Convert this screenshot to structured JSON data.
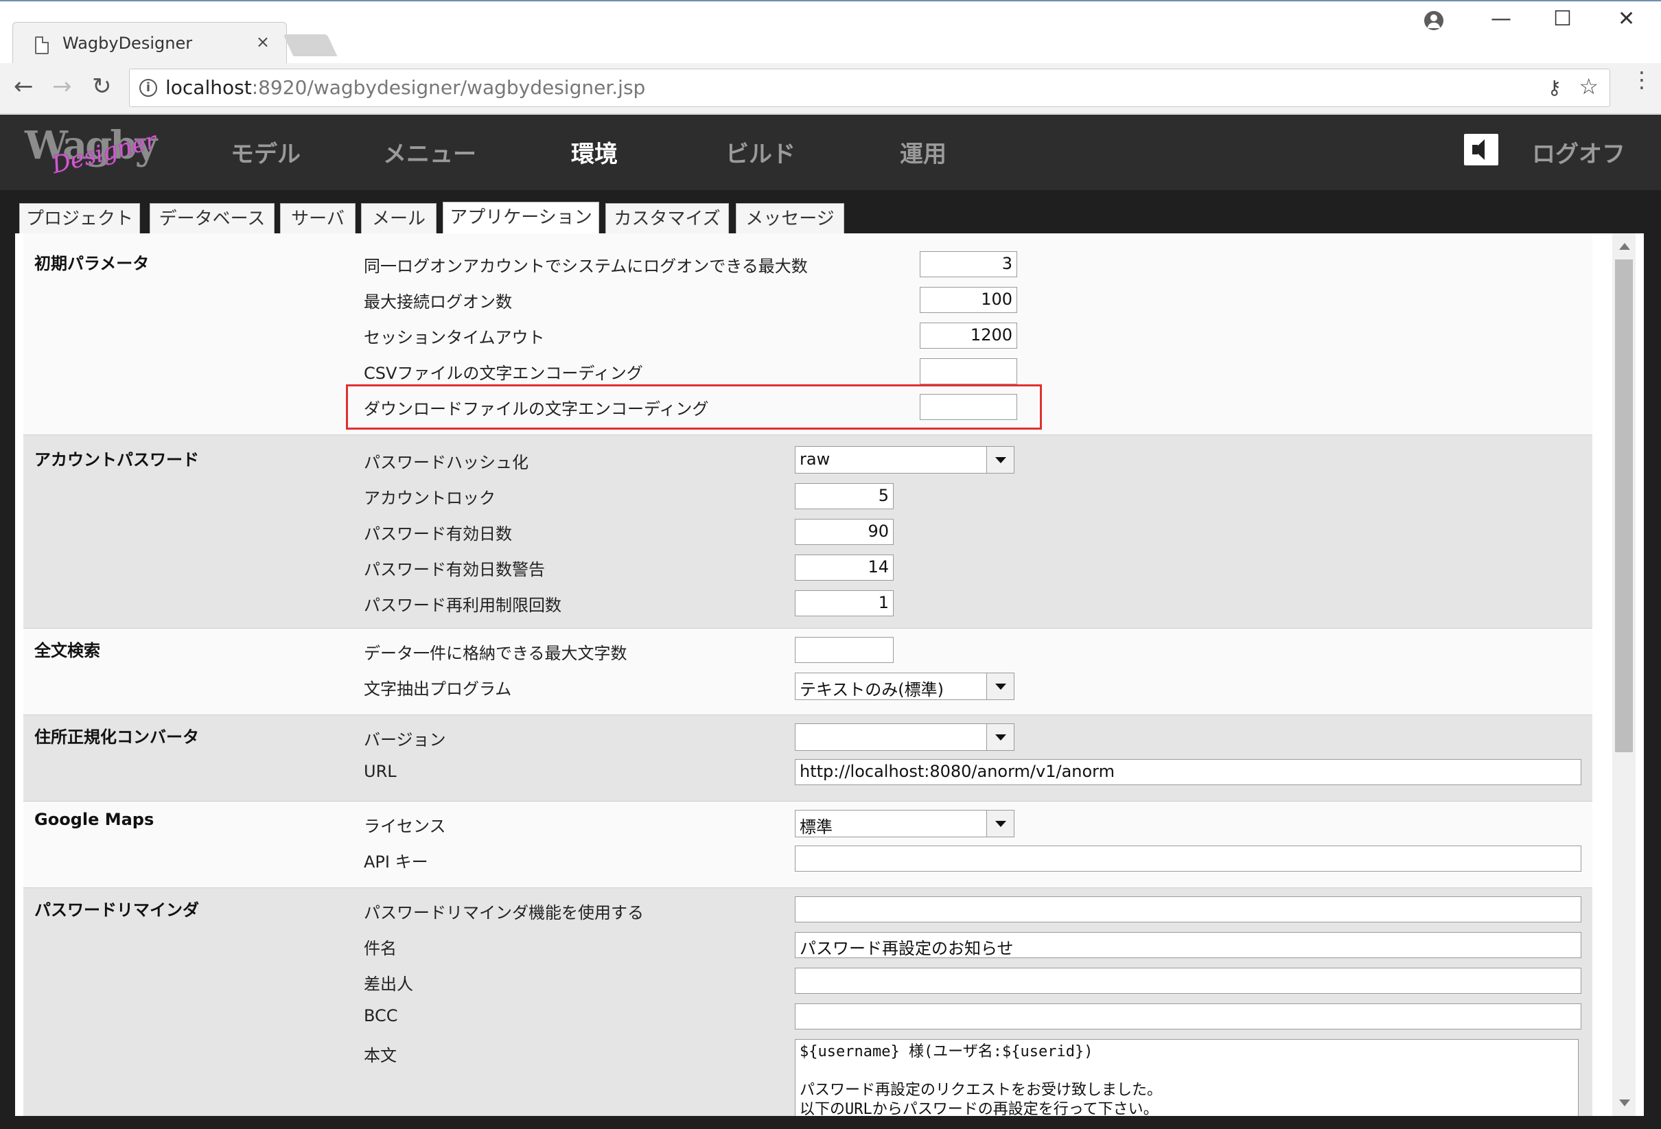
{
  "browser": {
    "tab_title": "WagbyDesigner",
    "tab_close": "×",
    "url_host": "localhost",
    "url_rest": ":8920/wagbydesigner/wagbydesigner.jsp",
    "controls": {
      "minimize": "—",
      "maximize": "☐",
      "close": "✕"
    },
    "nav": {
      "back": "←",
      "forward": "→",
      "reload": "↻"
    },
    "icons": {
      "info": "i",
      "key": "⚷",
      "star": "☆",
      "menu": "⋮"
    }
  },
  "app": {
    "logo_main": "Wagby",
    "logo_sub": "Designer",
    "nav": [
      {
        "label": "モデル"
      },
      {
        "label": "メニュー"
      },
      {
        "label": "環境"
      },
      {
        "label": "ビルド"
      },
      {
        "label": "運用"
      }
    ],
    "active_nav": "環境",
    "logoff": "ログオフ"
  },
  "subtabs": [
    "プロジェクト",
    "データベース",
    "サーバ",
    "メール",
    "アプリケーション",
    "カスタマイズ",
    "メッセージ"
  ],
  "active_subtab": "アプリケーション",
  "sections": {
    "initial": {
      "title": "初期パラメータ",
      "rows": [
        {
          "label": "同一ログオンアカウントでシステムにログオンできる最大数",
          "value": "3"
        },
        {
          "label": "最大接続ログオン数",
          "value": "100"
        },
        {
          "label": "セッションタイムアウト",
          "value": "1200"
        },
        {
          "label": "CSVファイルの文字エンコーディング",
          "value": ""
        },
        {
          "label": "ダウンロードファイルの文字エンコーディング",
          "value": ""
        }
      ]
    },
    "account": {
      "title": "アカウントパスワード",
      "rows": [
        {
          "label": "パスワードハッシュ化",
          "value": "raw"
        },
        {
          "label": "アカウントロック",
          "value": "5"
        },
        {
          "label": "パスワード有効日数",
          "value": "90"
        },
        {
          "label": "パスワード有効日数警告",
          "value": "14"
        },
        {
          "label": "パスワード再利用制限回数",
          "value": "1"
        }
      ]
    },
    "fulltext": {
      "title": "全文検索",
      "rows": [
        {
          "label": "データ一件に格納できる最大文字数",
          "value": ""
        },
        {
          "label": "文字抽出プログラム",
          "value": "テキストのみ(標準)"
        }
      ]
    },
    "address": {
      "title": "住所正規化コンバータ",
      "rows": [
        {
          "label": "バージョン",
          "value": ""
        },
        {
          "label": "URL",
          "value": "http://localhost:8080/anorm/v1/anorm"
        }
      ]
    },
    "gmaps": {
      "title": "Google Maps",
      "rows": [
        {
          "label": "ライセンス",
          "value": "標準"
        },
        {
          "label": "API キー",
          "value": ""
        }
      ]
    },
    "reminder": {
      "title": "パスワードリマインダ",
      "rows": [
        {
          "label": "パスワードリマインダ機能を使用する",
          "value": ""
        },
        {
          "label": "件名",
          "value": "パスワード再設定のお知らせ"
        },
        {
          "label": "差出人",
          "value": ""
        },
        {
          "label": "BCC",
          "value": ""
        },
        {
          "label": "本文",
          "value": ""
        }
      ],
      "body_lines": [
        "${username} 様(ユーザ名:${userid})",
        "",
        "パスワード再設定のリクエストをお受け致しました。",
        "以下のURLからパスワードの再設定を行って下さい。"
      ]
    }
  },
  "colors": {
    "appbar": "#2d2d2d",
    "frame": "#1f1f1f",
    "highlight_border": "#e03030",
    "section_grey": "#e5e5e5",
    "section_white": "#fafafa"
  }
}
